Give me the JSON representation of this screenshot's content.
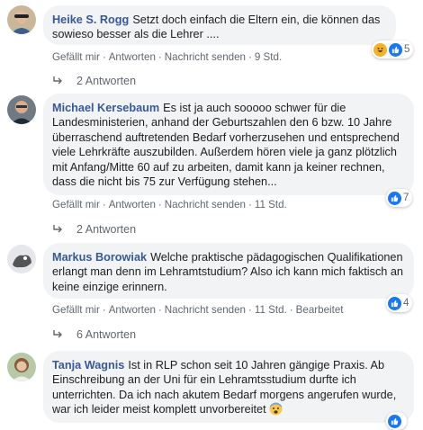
{
  "comments": [
    {
      "author": "Heike S. Rogg",
      "text": "Setzt doch einfach die Eltern ein, die können das sowieso besser als die Lehrer ....",
      "actions": [
        "Gefällt mir",
        "Antworten",
        "Nachricht senden",
        "9 Std."
      ],
      "reactions": {
        "icons": [
          "haha",
          "like"
        ],
        "count": "5"
      },
      "replies": "2 Antworten"
    },
    {
      "author": "Michael Kersebaum",
      "text": "Es ist ja auch sooooo schwer für die Landesministerien, anhand der Geburtszahlen den 6 bzw. 10 Jahre überraschend auftretenden Bedarf vorherzusehen und entsprechend viele Lehrkräfte auszubilden. Außerdem hören viele ja ganz plötzlich mit Anfang/Mitte 60 auf zu arbeiten, damit kann ja keiner rechnen, dass die nicht bis 75 zur Verfügung stehen...",
      "actions": [
        "Gefällt mir",
        "Antworten",
        "Nachricht senden",
        "11 Std."
      ],
      "reactions": {
        "icons": [
          "like"
        ],
        "count": "7"
      },
      "replies": "2 Antworten"
    },
    {
      "author": "Markus Borowiak",
      "text": "Welche praktische pädagogischen Qualifikationen erlangt man denn im Lehramtstudium? Also ich kann mich faktisch an keine einzige erinnern.",
      "actions": [
        "Gefällt mir",
        "Antworten",
        "Nachricht senden",
        "11 Std.",
        "Bearbeitet"
      ],
      "reactions": {
        "icons": [
          "like"
        ],
        "count": "4"
      },
      "replies": "6 Antworten"
    },
    {
      "author": "Tanja Wagnis",
      "text": "Ist in RLP schon seit 10 Jahren gängige Praxis. Ab Einschreibung an der Uni für ein Lehramtsstudium durfte ich unterrichten. Da ich nach akutem Bedarf morgens angerufen wurde, war ich leider meist komplett unvorbereitet",
      "emoji": "fearful-face",
      "reactions": {
        "icons": [
          "like"
        ],
        "count": ""
      }
    }
  ],
  "colors": {
    "link": "#385898",
    "bubble": "#f2f3f5",
    "meta": "#606770",
    "like": "#1877f2",
    "haha": "#f7b125"
  }
}
